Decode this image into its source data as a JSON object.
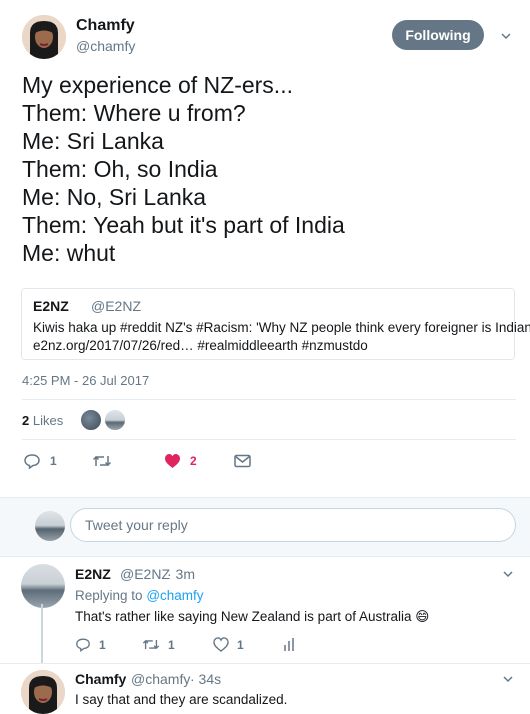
{
  "main_tweet": {
    "author_name": "Chamfy",
    "author_handle": "@chamfy",
    "follow_label": "Following",
    "lines": [
      "My experience of NZ-ers...",
      "Them: Where u from?",
      "Me: Sri Lanka",
      "Them: Oh, so India",
      "Me: No, Sri Lanka",
      "Them: Yeah but it's part of India",
      "Me: whut"
    ],
    "quoted": {
      "name": "E2NZ",
      "handle": "@E2NZ",
      "line1": "Kiwis haka up #reddit NZ's #Racism: 'Why NZ people think every foreigner is Indian?'",
      "line2": "e2nz.org/2017/07/26/red… #realmiddleearth #nzmustdo"
    },
    "timestamp": "4:25 PM - 26 Jul 2017",
    "likes_count": "2",
    "likes_label": "Likes",
    "reply_count": "1",
    "like_count": "2"
  },
  "reply_bar": {
    "placeholder": "Tweet your reply"
  },
  "replies": [
    {
      "name": "E2NZ",
      "handle": "@E2NZ",
      "time": "· 3m",
      "replying_prefix": "Replying to",
      "replying_to": "@chamfy",
      "text": "That's rather like saying New Zealand is part of Australia",
      "emoji": "😄",
      "reply_count": "1",
      "retweet_count": "1",
      "like_count": "1"
    },
    {
      "name": "Chamfy",
      "handle": "@chamfy",
      "time": "· 34s",
      "text": "I say that and they are scandalized."
    }
  ],
  "colors": {
    "like_active": "#e0245e",
    "muted": "#657786",
    "link": "#1da1f2"
  }
}
